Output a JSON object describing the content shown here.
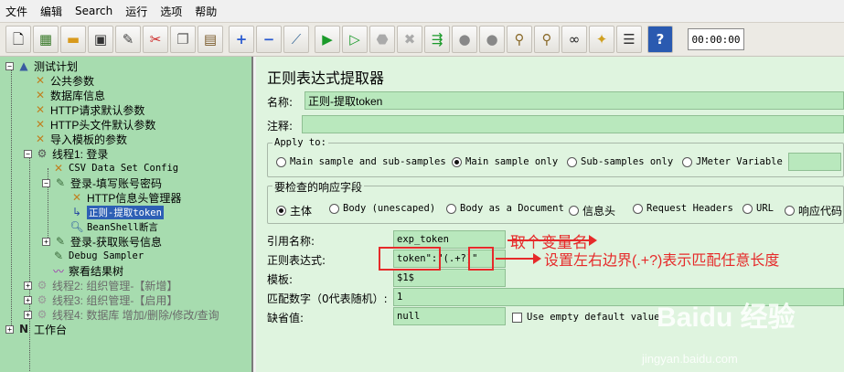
{
  "menu": [
    "文件",
    "编辑",
    "Search",
    "运行",
    "选项",
    "帮助"
  ],
  "toolbar": {
    "icons": [
      "new-icon",
      "templates-icon",
      "open-icon",
      "save-icon",
      "save-as-icon",
      "cut-icon",
      "copy-icon",
      "paste-icon",
      "expand-icon",
      "collapse-icon",
      "toggle-icon",
      "start-icon",
      "start-no-pause-icon",
      "stop-icon",
      "shutdown-icon",
      "remote-start-icon",
      "remote-stop-icon",
      "remote-exit-icon",
      "clear-icon",
      "clear-all-icon",
      "search-icon",
      "reset-search-icon",
      "function-helper-icon",
      "help-icon"
    ],
    "timer": "00:00:00"
  },
  "tree": {
    "items": [
      {
        "label": "测试计划"
      },
      {
        "label": "公共参数"
      },
      {
        "label": "数据库信息"
      },
      {
        "label": "HTTP请求默认参数"
      },
      {
        "label": "HTTP头文件默认参数"
      },
      {
        "label": "导入模板的参数"
      },
      {
        "label": "线程1: 登录"
      },
      {
        "label": "CSV Data Set Config"
      },
      {
        "label": "登录-填写账号密码"
      },
      {
        "label": "HTTP信息头管理器"
      },
      {
        "label": "正则-提取token"
      },
      {
        "label": "BeanShell断言"
      },
      {
        "label": "登录-获取账号信息"
      },
      {
        "label": "Debug Sampler"
      },
      {
        "label": "察看结果树"
      },
      {
        "label": "线程2: 组织管理-【新增】"
      },
      {
        "label": "线程3: 组织管理-【启用】"
      },
      {
        "label": "线程4: 数据库 增加/删除/修改/查询"
      },
      {
        "label": "工作台"
      }
    ]
  },
  "panel": {
    "title": "正则表达式提取器",
    "name_label": "名称:",
    "name_value": "正则-提取token",
    "comment_label": "注释:",
    "comment_value": "",
    "apply_to": {
      "title": "Apply to:",
      "options": [
        "Main sample and sub-samples",
        "Main sample only",
        "Sub-samples only",
        "JMeter Variable"
      ],
      "selected": "Main sample only"
    },
    "response_field": {
      "title": "要检查的响应字段",
      "options": [
        "主体",
        "Body (unescaped)",
        "Body as a Document",
        "信息头",
        "Request Headers",
        "URL",
        "响应代码"
      ],
      "selected": "主体"
    },
    "refname_label": "引用名称:",
    "refname_value": "exp_token",
    "regex_label": "正则表达式:",
    "regex_value": "token\":\"(.+?)\"",
    "template_label": "模板:",
    "template_value": "$1$",
    "match_label": "匹配数字（0代表随机）:",
    "match_value": "1",
    "default_label": "缺省值:",
    "default_value": "null",
    "empty_default_label": "Use empty default value"
  },
  "annotations": {
    "note1": "取个变量名",
    "note2": "设置左右边界(.+?)表示匹配任意长度"
  },
  "watermark": {
    "logo": "Baidu 经验",
    "url": "jingyan.baidu.com"
  }
}
